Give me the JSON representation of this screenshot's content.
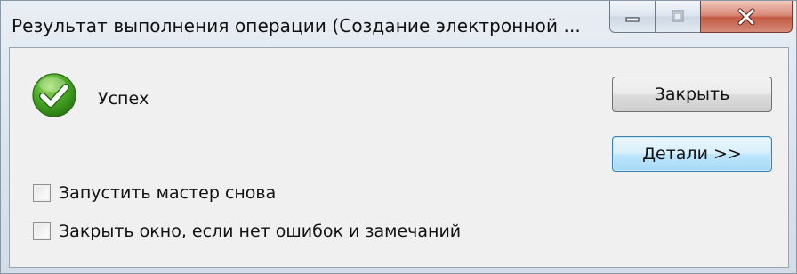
{
  "window": {
    "title": "Результат выполнения операции (Создание электронной ..."
  },
  "status": {
    "icon": "check-circle-icon",
    "text": "Успех",
    "color": "#3e9d1d"
  },
  "buttons": {
    "close_label": "Закрыть",
    "details_label": "Детали >>"
  },
  "options": [
    {
      "label": "Запустить мастер снова",
      "checked": false
    },
    {
      "label": "Закрыть окно, если нет ошибок и замечаний",
      "checked": false
    }
  ],
  "colors": {
    "close_caption": "#c25a44",
    "focus_button": "#3c7fb1"
  }
}
